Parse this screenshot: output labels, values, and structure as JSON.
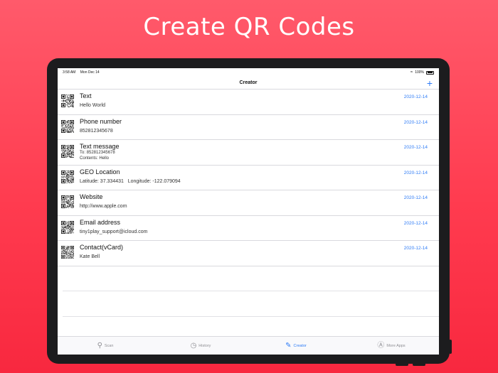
{
  "headline": "Create QR Codes",
  "status": {
    "time": "3:58 AM",
    "date": "Mon Dec 14",
    "battery": "100%"
  },
  "nav": {
    "title": "Creator",
    "add_label": "+"
  },
  "rows": [
    {
      "title": "Text",
      "sub": "Hello World",
      "date": "2020-12-14"
    },
    {
      "title": "Phone number",
      "sub": "852812345678",
      "date": "2020-12-14"
    },
    {
      "title": "Text message",
      "sub_line1": "To: 852812345678",
      "sub_line2": "Contents: Hello",
      "date": "2020-12-14"
    },
    {
      "title": "GEO Location",
      "sub": "Latitude: 37.334431   Longitude: -122.079094",
      "date": "2020-12-14"
    },
    {
      "title": "Website",
      "sub": "http://www.apple.com",
      "date": "2020-12-14"
    },
    {
      "title": "Email address",
      "sub": "tiny1play_support@icloud.com",
      "date": "2020-12-14"
    },
    {
      "title": "Contact(vCard)",
      "sub": "Kate Bell",
      "date": "2020-12-14"
    }
  ],
  "tabs": [
    {
      "label": "Scan",
      "icon": "magnifier-icon"
    },
    {
      "label": "History",
      "icon": "clock-icon"
    },
    {
      "label": "Creator",
      "icon": "edit-icon"
    },
    {
      "label": "More Apps",
      "icon": "app-store-icon"
    }
  ],
  "colors": {
    "accent": "#2f7cf6",
    "background": "#ff3b4f"
  }
}
